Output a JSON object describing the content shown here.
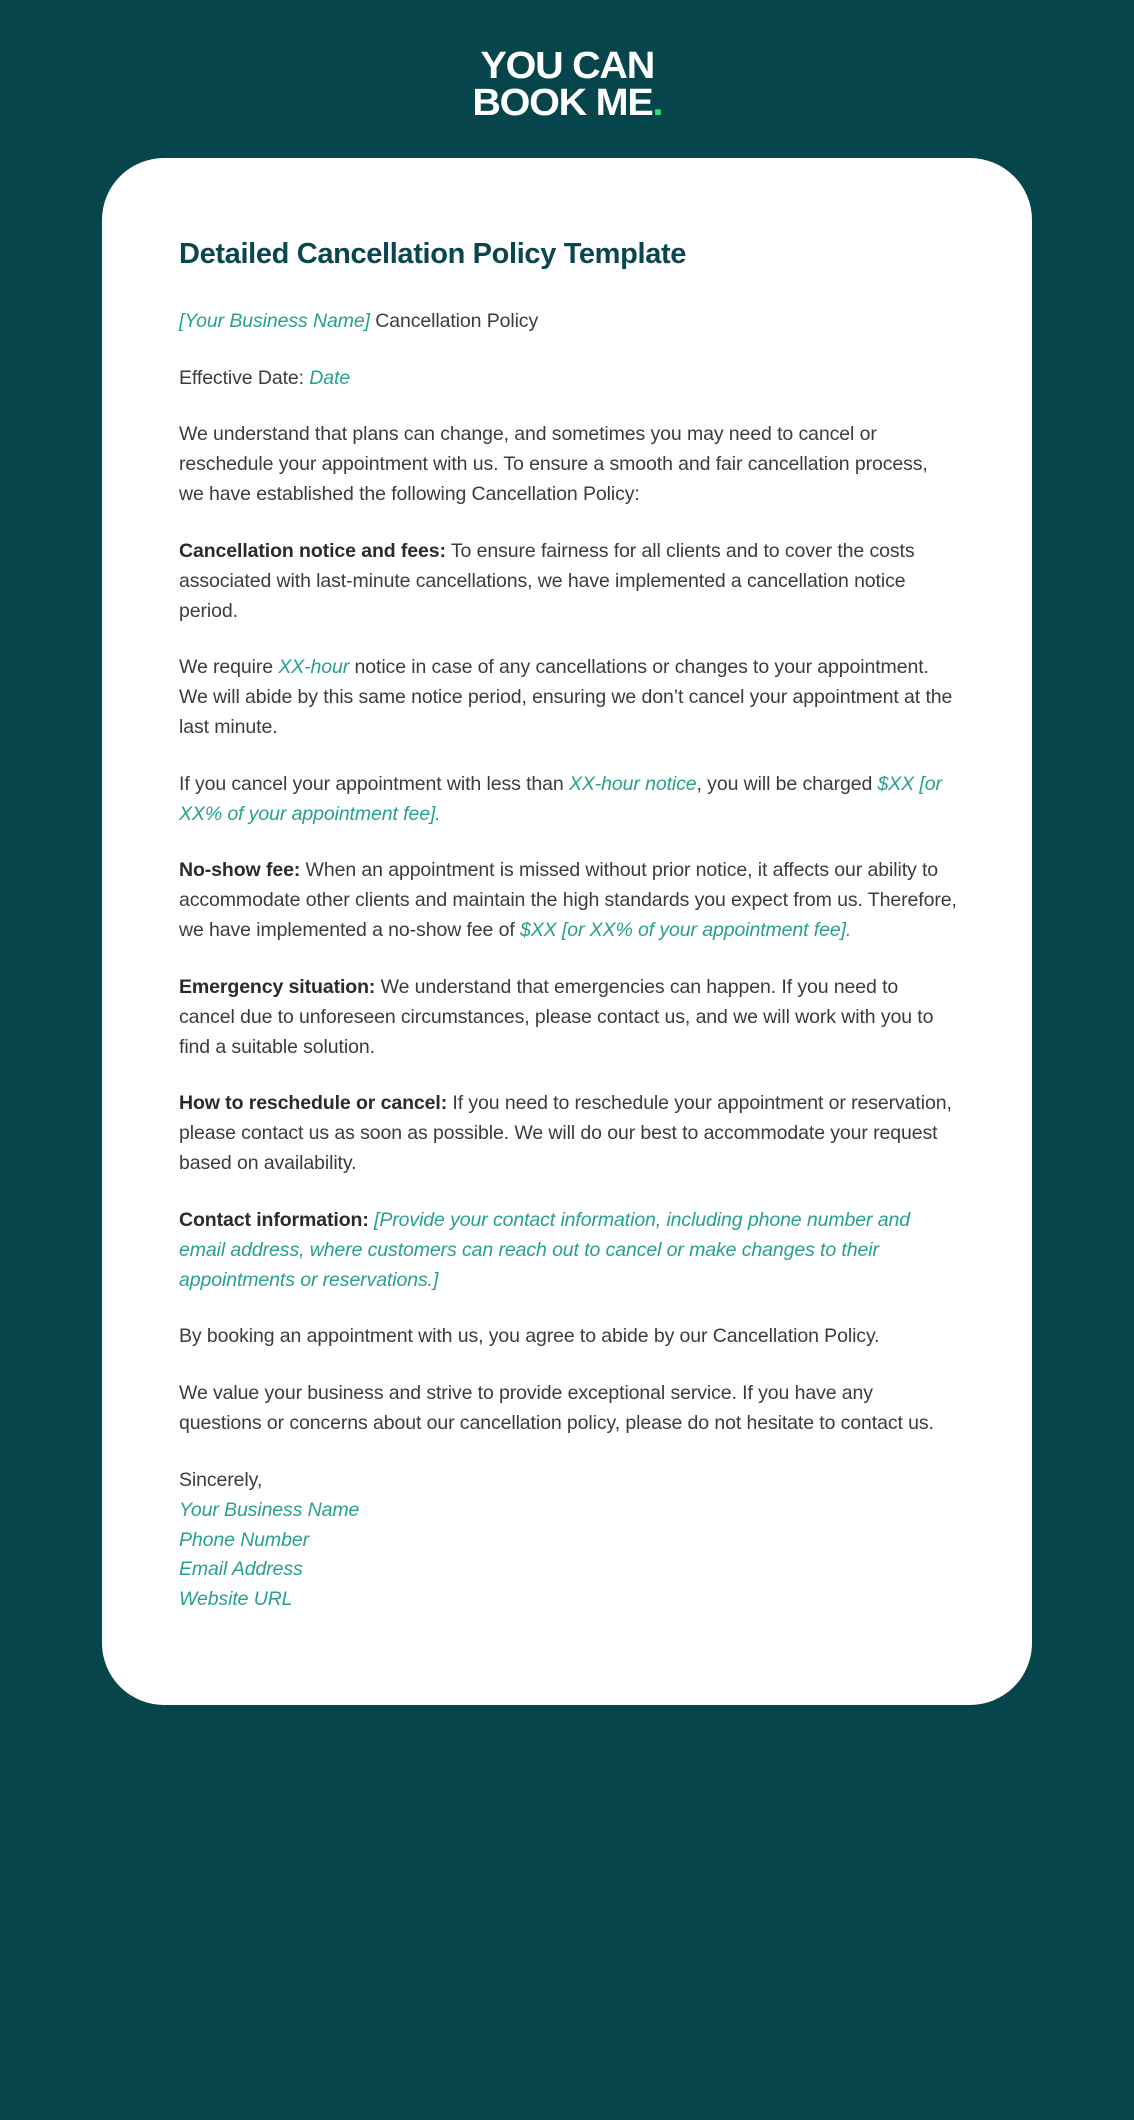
{
  "brand": {
    "logo_line_1": "YOU CAN",
    "logo_line_2": "BOOK ME",
    "logo_dot": ".",
    "logo_dot_color": "#2fe07c",
    "background_color": "#06454b",
    "card_color": "#ffffff",
    "heading_color": "#0b4650",
    "placeholder_color": "#27a18c",
    "body_text_color": "#3c3c3c"
  },
  "document": {
    "title": "Detailed Cancellation Policy Template",
    "business_line": {
      "placeholder": "[Your Business Name]",
      "rest": " Cancellation Policy"
    },
    "effective_date": {
      "label": "Effective Date: ",
      "placeholder": "Date"
    },
    "intro": "We understand that plans can change, and sometimes you may need to cancel or reschedule your appointment with us. To ensure a smooth and fair cancellation process, we have established the following Cancellation Policy:",
    "cancellation_notice": {
      "lead": "Cancellation notice and fees:",
      "body": " To ensure fairness for all clients and to cover the costs associated with last-minute cancellations, we have implemented a cancellation notice period."
    },
    "notice_requirement": {
      "part1": "We require ",
      "placeholder1": "XX-hour",
      "part2": " notice in case of any cancellations or changes to your appointment. We will abide by this same notice period, ensuring we don’t cancel your appointment at the last minute."
    },
    "late_cancel_fee": {
      "part1": "If you cancel your appointment with less than ",
      "placeholder1": "XX-hour notice",
      "part2": ", you will be charged ",
      "placeholder2": "$XX [or XX% of your appointment fee]."
    },
    "no_show_fee": {
      "lead": "No-show fee:",
      "part1": " When an appointment is missed without prior notice, it affects our ability to accommodate other clients and maintain the high standards you expect from us. Therefore, we have implemented a no-show fee of ",
      "placeholder1": "$XX [or XX% of your appointment fee]."
    },
    "emergency": {
      "lead": "Emergency situation:",
      "body": " We understand that emergencies can happen. If you need to cancel due to unforeseen circumstances, please contact us, and we will work with you to find a suitable solution."
    },
    "how_to_reschedule": {
      "lead": "How to reschedule or cancel:",
      "body": " If you need to reschedule your appointment or reservation, please contact us as soon as possible. We will do our best to accommodate your request based on availability."
    },
    "contact_information": {
      "lead": "Contact information:",
      "placeholder": " [Provide your contact information, including phone number and email address, where customers can reach out to cancel or make changes to their appointments or reservations.]"
    },
    "agreement": "By booking an appointment with us, you agree to abide by our Cancellation Policy.",
    "closing": "We value your business and strive to provide exceptional service. If you have any questions or concerns about our cancellation policy, please do not hesitate to contact us.",
    "signature": {
      "salutation": "Sincerely,",
      "business_name": "Your Business Name",
      "phone_number": "Phone Number",
      "email_address": "Email Address",
      "website_url": "Website URL"
    }
  }
}
